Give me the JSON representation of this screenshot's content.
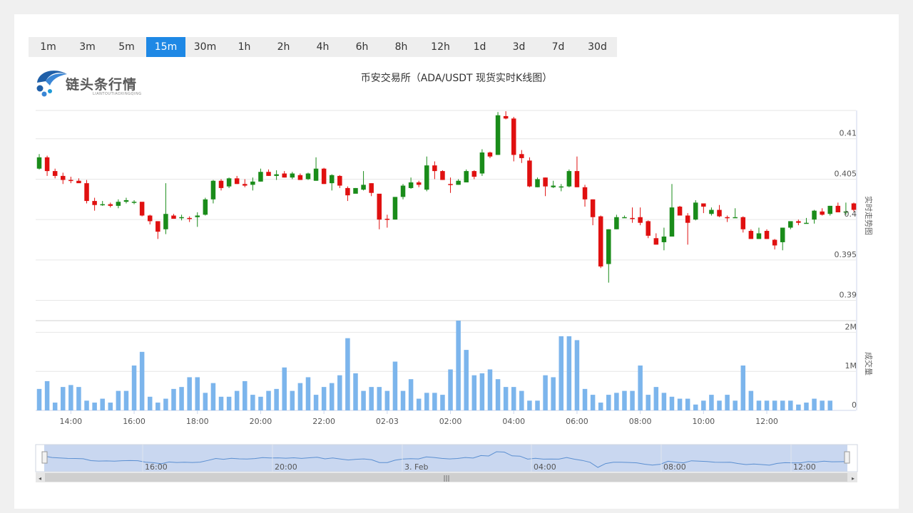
{
  "timeframes": {
    "items": [
      "1m",
      "3m",
      "5m",
      "15m",
      "30m",
      "1h",
      "2h",
      "4h",
      "6h",
      "8h",
      "12h",
      "1d",
      "3d",
      "7d",
      "30d"
    ],
    "active_index": 3
  },
  "logo": {
    "name": "链头条行情",
    "sub": "LIANTOUTIAOXINGQING"
  },
  "chart_title": "币安交易所（ADA/USDT 现货实时K线图）",
  "colors": {
    "up": "#1a8c1a",
    "down": "#e01010",
    "volume": "#7cb5ec",
    "accent": "#1e88e5",
    "navigator_fill": "#c5d5ef"
  },
  "chart_data": {
    "type": "candlestick",
    "price_axis": {
      "label": "实时走势图",
      "ticks": [
        "0.41",
        "0.405",
        "0.4",
        "0.395",
        "0.39"
      ],
      "ylim": [
        0.3875,
        0.4135
      ]
    },
    "volume_axis": {
      "label": "成交量",
      "ticks": [
        "2M",
        "1M",
        "0"
      ],
      "ylim": [
        0,
        2300000
      ]
    },
    "x_ticks": [
      "14:00",
      "16:00",
      "18:00",
      "20:00",
      "22:00",
      "02-03",
      "02:00",
      "04:00",
      "06:00",
      "08:00",
      "10:00",
      "12:00"
    ],
    "navigator_labels": [
      "16:00",
      "20:00",
      "3. Feb",
      "04:00",
      "08:00",
      "12:00"
    ],
    "candles": [
      [
        0.4063,
        0.4077,
        0.4081,
        0.4062
      ],
      [
        0.4077,
        0.406,
        0.4079,
        0.4054
      ],
      [
        0.406,
        0.4054,
        0.4063,
        0.4051
      ],
      [
        0.4054,
        0.4049,
        0.4058,
        0.4044
      ],
      [
        0.4049,
        0.4048,
        0.4053,
        0.4045
      ],
      [
        0.4048,
        0.4045,
        0.4051,
        0.4046
      ],
      [
        0.4045,
        0.4023,
        0.4049,
        0.402
      ],
      [
        0.4023,
        0.4018,
        0.4027,
        0.4011
      ],
      [
        0.4018,
        0.4019,
        0.4023,
        0.4017
      ],
      [
        0.4019,
        0.4017,
        0.4021,
        0.4015
      ],
      [
        0.4017,
        0.4022,
        0.4025,
        0.4014
      ],
      [
        0.4022,
        0.4024,
        0.4027,
        0.402
      ],
      [
        0.4022,
        0.4022,
        0.4024,
        0.4019
      ],
      [
        0.4022,
        0.4005,
        0.4021,
        0.4004
      ],
      [
        0.4005,
        0.3998,
        0.4006,
        0.3994
      ],
      [
        0.3998,
        0.3985,
        0.3998,
        0.3976
      ],
      [
        0.3988,
        0.4007,
        0.4045,
        0.3982
      ],
      [
        0.4005,
        0.4001,
        0.4007,
        0.4001
      ],
      [
        0.4002,
        0.4003,
        0.4006,
        0.3999
      ],
      [
        0.4002,
        0.4001,
        0.4004,
        0.3997
      ],
      [
        0.4003,
        0.4005,
        0.4009,
        0.3991
      ],
      [
        0.4006,
        0.4025,
        0.4027,
        0.4005
      ],
      [
        0.4025,
        0.4048,
        0.4049,
        0.402
      ],
      [
        0.4048,
        0.4039,
        0.405,
        0.4036
      ],
      [
        0.4041,
        0.4051,
        0.4052,
        0.4039
      ],
      [
        0.4051,
        0.4044,
        0.4054,
        0.4044
      ],
      [
        0.4044,
        0.4042,
        0.405,
        0.404
      ],
      [
        0.4043,
        0.4047,
        0.4052,
        0.4036
      ],
      [
        0.4047,
        0.4059,
        0.4063,
        0.4047
      ],
      [
        0.4059,
        0.4054,
        0.4062,
        0.4054
      ],
      [
        0.4054,
        0.4056,
        0.4061,
        0.4049
      ],
      [
        0.4057,
        0.4052,
        0.406,
        0.4052
      ],
      [
        0.4052,
        0.4057,
        0.4059,
        0.405
      ],
      [
        0.4055,
        0.4049,
        0.4057,
        0.4049
      ],
      [
        0.405,
        0.4057,
        0.4058,
        0.4049
      ],
      [
        0.4048,
        0.4063,
        0.4077,
        0.4048
      ],
      [
        0.4063,
        0.4044,
        0.4064,
        0.4044
      ],
      [
        0.4045,
        0.4055,
        0.4056,
        0.4036
      ],
      [
        0.4054,
        0.4042,
        0.4055,
        0.4039
      ],
      [
        0.4039,
        0.403,
        0.4041,
        0.4023
      ],
      [
        0.4032,
        0.4039,
        0.4039,
        0.4033
      ],
      [
        0.4037,
        0.4043,
        0.406,
        0.4036
      ],
      [
        0.4045,
        0.4033,
        0.4045,
        0.4029
      ],
      [
        0.4032,
        0.4,
        0.4031,
        0.3988
      ],
      [
        0.4001,
        0.4,
        0.4006,
        0.399
      ],
      [
        0.4,
        0.4028,
        0.4028,
        0.4
      ],
      [
        0.4028,
        0.4042,
        0.4044,
        0.4025
      ],
      [
        0.4039,
        0.4046,
        0.4052,
        0.4038
      ],
      [
        0.4046,
        0.4043,
        0.4048,
        0.404
      ],
      [
        0.4037,
        0.4067,
        0.4078,
        0.4035
      ],
      [
        0.4067,
        0.406,
        0.4072,
        0.405
      ],
      [
        0.406,
        0.4049,
        0.4061,
        0.4049
      ],
      [
        0.4044,
        0.4043,
        0.4052,
        0.4033
      ],
      [
        0.4043,
        0.4048,
        0.405,
        0.4043
      ],
      [
        0.4046,
        0.406,
        0.4062,
        0.4046
      ],
      [
        0.406,
        0.4053,
        0.4061,
        0.405
      ],
      [
        0.4057,
        0.4083,
        0.4087,
        0.4054
      ],
      [
        0.4083,
        0.4078,
        0.4084,
        0.4076
      ],
      [
        0.408,
        0.4129,
        0.4133,
        0.408
      ],
      [
        0.4128,
        0.4125,
        0.4134,
        0.4124
      ],
      [
        0.4125,
        0.408,
        0.4127,
        0.4072
      ],
      [
        0.4081,
        0.4076,
        0.4086,
        0.407
      ],
      [
        0.4073,
        0.4041,
        0.4077,
        0.404
      ],
      [
        0.404,
        0.405,
        0.4052,
        0.404
      ],
      [
        0.4052,
        0.4041,
        0.4052,
        0.4029
      ],
      [
        0.404,
        0.4042,
        0.4048,
        0.4039
      ],
      [
        0.404,
        0.4041,
        0.4044,
        0.4035
      ],
      [
        0.4041,
        0.406,
        0.4062,
        0.404
      ],
      [
        0.406,
        0.404,
        0.4078,
        0.404
      ],
      [
        0.404,
        0.4025,
        0.4043,
        0.4016
      ],
      [
        0.4025,
        0.4003,
        0.4025,
        0.3993
      ],
      [
        0.4004,
        0.3942,
        0.4005,
        0.394
      ],
      [
        0.3945,
        0.3988,
        0.3988,
        0.3922
      ],
      [
        0.3988,
        0.4003,
        0.4006,
        0.3988
      ],
      [
        0.4003,
        0.4003,
        0.4005,
        0.4003
      ],
      [
        0.4002,
        0.4001,
        0.4015,
        0.3996
      ],
      [
        0.4003,
        0.3996,
        0.4015,
        0.3993
      ],
      [
        0.3998,
        0.398,
        0.3999,
        0.3977
      ],
      [
        0.3977,
        0.3969,
        0.3983,
        0.3969
      ],
      [
        0.3972,
        0.3979,
        0.399,
        0.3962
      ],
      [
        0.3979,
        0.4015,
        0.4044,
        0.3979
      ],
      [
        0.4016,
        0.4005,
        0.4017,
        0.4005
      ],
      [
        0.4005,
        0.3996,
        0.4008,
        0.3969
      ],
      [
        0.4,
        0.4021,
        0.4024,
        0.3999
      ],
      [
        0.402,
        0.4016,
        0.402,
        0.4008
      ],
      [
        0.4007,
        0.4012,
        0.4015,
        0.4005
      ],
      [
        0.4012,
        0.4004,
        0.4018,
        0.4003
      ],
      [
        0.4003,
        0.4002,
        0.4005,
        0.3997
      ],
      [
        0.4002,
        0.4003,
        0.4014,
        0.4003
      ],
      [
        0.4003,
        0.3988,
        0.4004,
        0.3984
      ],
      [
        0.3986,
        0.3976,
        0.3988,
        0.3976
      ],
      [
        0.3976,
        0.3983,
        0.399,
        0.3976
      ],
      [
        0.3986,
        0.3976,
        0.3988,
        0.3976
      ],
      [
        0.3975,
        0.3968,
        0.3976,
        0.3963
      ],
      [
        0.3972,
        0.399,
        0.399,
        0.3962
      ],
      [
        0.399,
        0.3998,
        0.3998,
        0.3988
      ],
      [
        0.3998,
        0.3996,
        0.4,
        0.3993
      ],
      [
        0.3995,
        0.3996,
        0.4002,
        0.3995
      ],
      [
        0.4,
        0.4011,
        0.4012,
        0.3995
      ],
      [
        0.401,
        0.4006,
        0.4014,
        0.4005
      ],
      [
        0.4007,
        0.4017,
        0.4017,
        0.4005
      ],
      [
        0.4017,
        0.4009,
        0.4021,
        0.4009
      ],
      [
        0.4009,
        0.401,
        0.4021,
        0.4006
      ],
      [
        0.402,
        0.4012,
        0.4021,
        0.401
      ]
    ],
    "volumes": [
      0.55,
      0.75,
      0.2,
      0.6,
      0.65,
      0.6,
      0.25,
      0.2,
      0.3,
      0.2,
      0.5,
      0.5,
      1.15,
      1.5,
      0.35,
      0.2,
      0.3,
      0.55,
      0.6,
      0.85,
      0.85,
      0.45,
      0.7,
      0.35,
      0.35,
      0.5,
      0.75,
      0.4,
      0.35,
      0.5,
      0.55,
      1.1,
      0.5,
      0.7,
      0.85,
      0.4,
      0.6,
      0.7,
      0.9,
      1.85,
      0.95,
      0.5,
      0.6,
      0.6,
      0.5,
      1.25,
      0.5,
      0.8,
      0.3,
      0.45,
      0.45,
      0.4,
      1.05,
      2.3,
      1.55,
      0.9,
      0.95,
      1.05,
      0.8,
      0.6,
      0.6,
      0.5,
      0.25,
      0.25,
      0.9,
      0.85,
      1.9,
      1.9,
      1.8,
      0.55,
      0.4,
      0.2,
      0.4,
      0.45,
      0.5,
      0.5,
      1.15,
      0.4,
      0.6,
      0.45,
      0.35,
      0.3,
      0.3,
      0.15,
      0.25,
      0.4,
      0.25,
      0.4,
      0.25,
      1.15,
      0.5,
      0.25,
      0.25,
      0.25,
      0.25,
      0.25,
      0.15,
      0.2,
      0.3,
      0.25,
      0.25
    ]
  }
}
